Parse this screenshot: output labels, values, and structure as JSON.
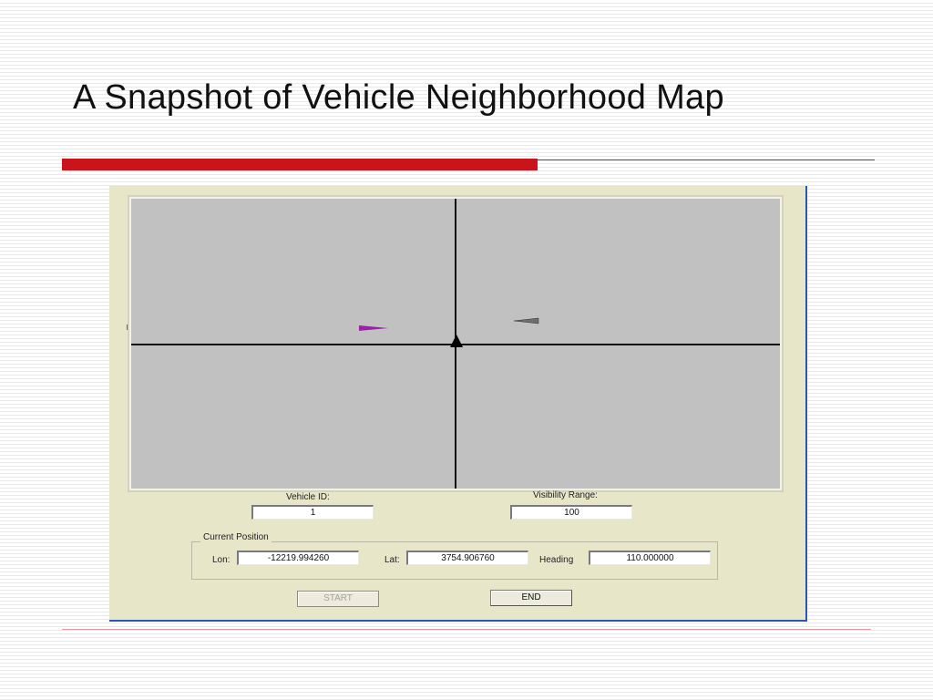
{
  "slide": {
    "title": "A Snapshot of Vehicle Neighborhood Map"
  },
  "app": {
    "vehicle_id": {
      "label": "Vehicle ID:",
      "value": "1"
    },
    "visibility_range": {
      "label": "Visibility Range:",
      "value": "100"
    },
    "current_position": {
      "title": "Current Position",
      "lon": {
        "label": "Lon:",
        "value": "-12219.994260"
      },
      "lat": {
        "label": "Lat:",
        "value": "3754.906760"
      },
      "heading": {
        "label": "Heading",
        "value": "110.000000"
      }
    },
    "buttons": {
      "start": "START",
      "end": "END"
    },
    "map": {
      "background": "#c1c1c1",
      "vehicles": [
        {
          "role": "self",
          "color": "#000000",
          "icon": "triangle-up-icon"
        },
        {
          "role": "neighbor",
          "color": "#9b1fa8",
          "icon": "vehicle-arrow-icon"
        },
        {
          "role": "neighbor",
          "color": "#6e6e6e",
          "icon": "vehicle-arrow-icon"
        }
      ]
    }
  },
  "colors": {
    "accent_red": "#c8141a",
    "window_bg": "#e8e6c9",
    "window_border": "#2a56b5"
  }
}
